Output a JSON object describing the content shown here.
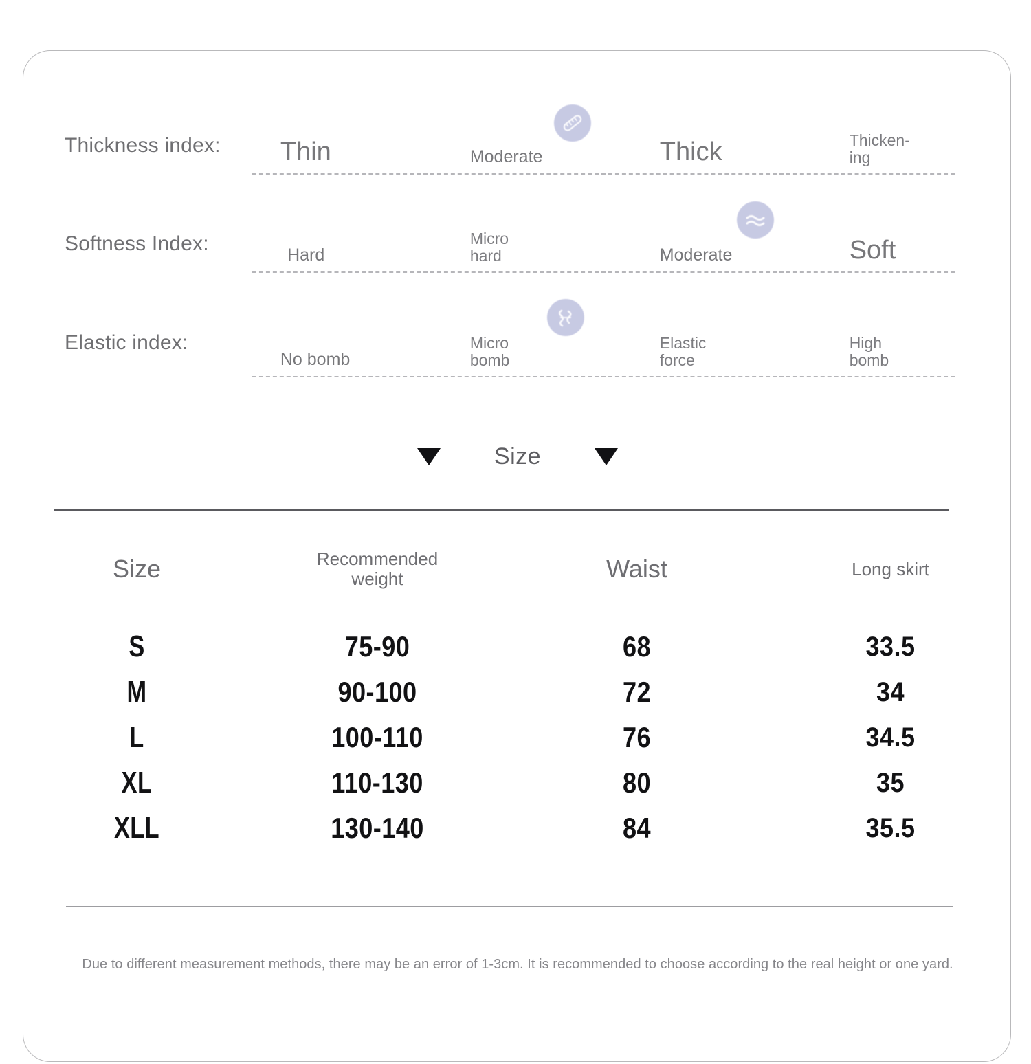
{
  "card": {
    "indices": [
      {
        "title": "Thickness index:",
        "icon": "ruler-icon",
        "marker_position_pct": 43,
        "ticks": [
          {
            "label": "Thin",
            "emphasis": "large",
            "left_pct": 4
          },
          {
            "label": "Moderate",
            "emphasis": "medium",
            "left_pct": 31
          },
          {
            "label": "Thick",
            "emphasis": "large",
            "left_pct": 58
          },
          {
            "label": "Thicken-\ning",
            "emphasis": "small",
            "left_pct": 85
          }
        ]
      },
      {
        "title": "Softness Index:",
        "icon": "wave-icon",
        "marker_position_pct": 69,
        "ticks": [
          {
            "label": "Hard",
            "emphasis": "medium",
            "left_pct": 5
          },
          {
            "label": "Micro\nhard",
            "emphasis": "small",
            "left_pct": 31
          },
          {
            "label": "Moderate",
            "emphasis": "medium",
            "left_pct": 58
          },
          {
            "label": "Soft",
            "emphasis": "large",
            "left_pct": 85
          }
        ]
      },
      {
        "title": "Elastic index:",
        "icon": "spring-icon",
        "marker_position_pct": 42,
        "ticks": [
          {
            "label": "No bomb",
            "emphasis": "medium",
            "left_pct": 4
          },
          {
            "label": "Micro\nbomb",
            "emphasis": "small",
            "left_pct": 31
          },
          {
            "label": "Elastic\nforce",
            "emphasis": "small",
            "left_pct": 58
          },
          {
            "label": "High\nbomb",
            "emphasis": "small",
            "left_pct": 85
          }
        ]
      }
    ],
    "size_divider": {
      "label": "Size",
      "left_arrow": "triangle-down-icon",
      "right_arrow": "triangle-down-icon"
    },
    "table": {
      "headers": {
        "size": "Size",
        "weight": "Recommended\nweight",
        "waist": "Waist",
        "skirt": "Long skirt"
      },
      "rows": [
        {
          "size": "S",
          "weight": "75-90",
          "waist": "68",
          "skirt": "33.5"
        },
        {
          "size": "M",
          "weight": "90-100",
          "waist": "72",
          "skirt": "34"
        },
        {
          "size": "L",
          "weight": "100-110",
          "waist": "76",
          "skirt": "34.5"
        },
        {
          "size": "XL",
          "weight": "110-130",
          "waist": "80",
          "skirt": "35"
        },
        {
          "size": "XLL",
          "weight": "130-140",
          "waist": "84",
          "skirt": "35.5"
        }
      ]
    },
    "footer_note": "Due to different measurement methods, there may be an error of 1-3cm. It is recommended to choose according to the real height or one yard.",
    "colors": {
      "badge": "#c0c3e0",
      "text_muted": "#77777a",
      "text_dark": "#121214",
      "border": "#b9b9bb",
      "dash": "#b6b6ba"
    }
  }
}
